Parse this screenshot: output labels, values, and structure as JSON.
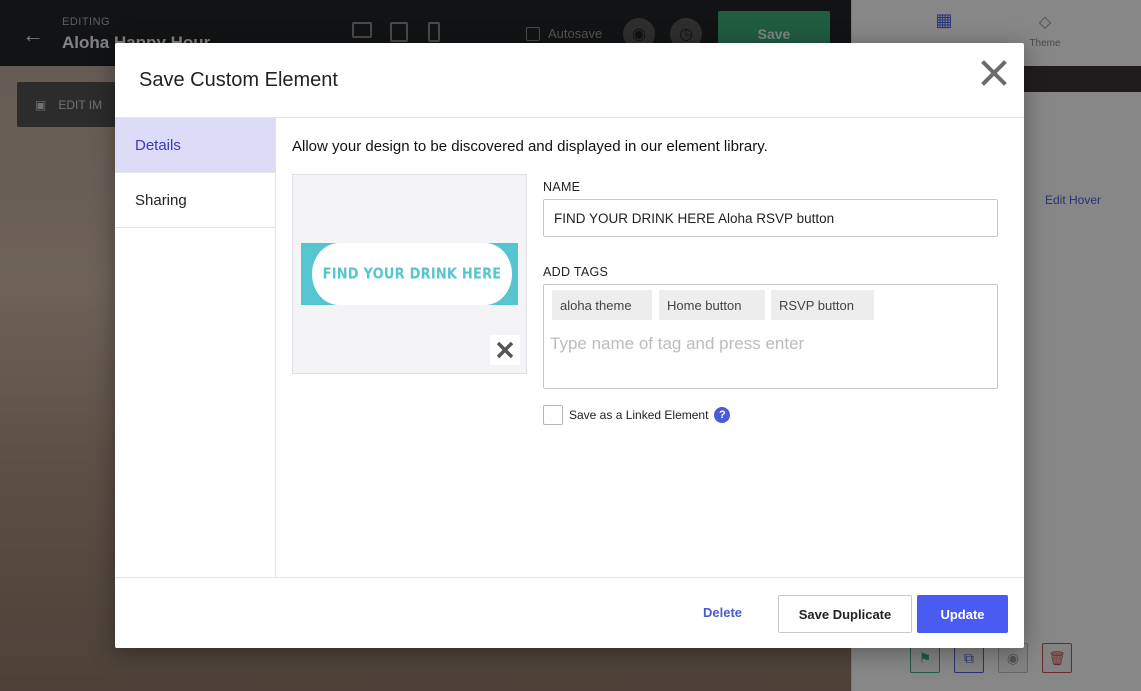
{
  "app": {
    "editing_label": "EDITING",
    "page_title": "Aloha Happy Hour",
    "autosave_label": "Autosave",
    "save_label": "Save",
    "edit_image_label": "EDIT IM",
    "edit_hover_label": "Edit Hover",
    "theme_tab_label": "Theme"
  },
  "modal": {
    "title": "Save Custom Element",
    "nav": [
      {
        "label": "Details",
        "active": true
      },
      {
        "label": "Sharing",
        "active": false
      }
    ],
    "intro": "Allow your design to be discovered and displayed in our element library.",
    "preview_text": "FIND YOUR DRINK HERE",
    "name_label": "NAME",
    "name_value": "FIND YOUR DRINK HERE Aloha RSVP button",
    "tags_label": "ADD TAGS",
    "tags": [
      "aloha theme",
      "Home button",
      "RSVP button"
    ],
    "tags_placeholder": "Type name of tag and press enter",
    "linked_label": "Save as a Linked Element",
    "help_glyph": "?",
    "buttons": {
      "delete": "Delete",
      "duplicate": "Save Duplicate",
      "update": "Update"
    }
  },
  "colors": {
    "accent": "#4a5bf2",
    "nav_active_bg": "#dcdcf8",
    "preview_teal": "#55c5cf",
    "save_green": "#3aa876"
  }
}
